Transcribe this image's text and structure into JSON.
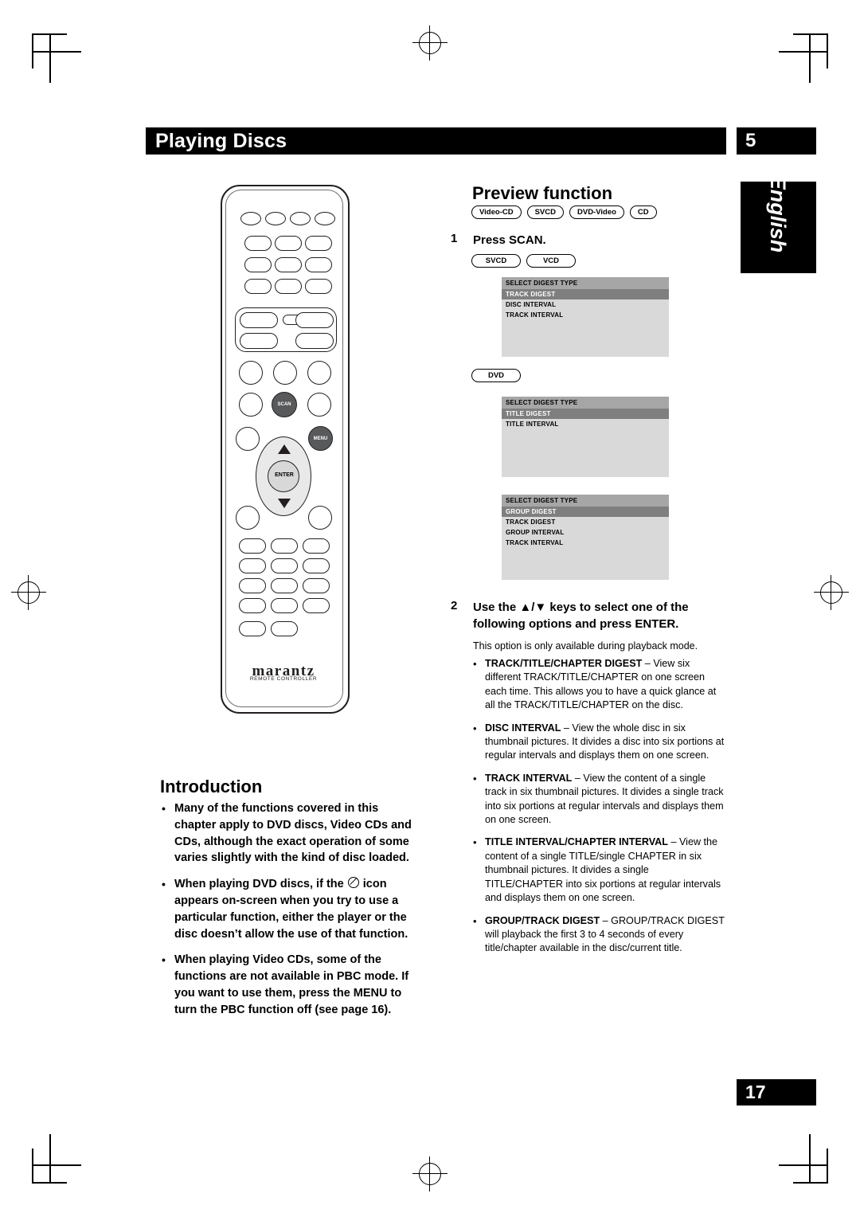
{
  "header": {
    "title": "Playing Discs",
    "chapter_number": "5",
    "language_tab": "English",
    "page_number": "17"
  },
  "remote": {
    "brand": "marantz",
    "sub_label": "REMOTE CONTROLLER",
    "scan_label": "SCAN",
    "menu_label": "MENU",
    "enter_label": "ENTER"
  },
  "left": {
    "intro_heading": "Introduction",
    "bullets": [
      "Many of the functions covered in this chapter apply to DVD discs, Video CDs and CDs, although the exact operation of some varies slightly with the kind of disc loaded.",
      "When playing DVD discs, if the ⊘ icon appears on-screen when you try to use a particular function, either the player or the disc doesn’t allow the use of that function.",
      "When playing Video CDs, some of the functions are not available in PBC mode. If you want to use them, press the MENU to turn the PBC function off (see page 16)."
    ]
  },
  "right": {
    "heading": "Preview function",
    "disc_badges": [
      "Video-CD",
      "SVCD",
      "DVD-Video",
      "CD"
    ],
    "step1_num": "1",
    "step1_text": "Press SCAN.",
    "badges_svcd_vcd": [
      "SVCD",
      "VCD"
    ],
    "osd_svcd": {
      "header": "SELECT DIGEST TYPE",
      "rows": [
        {
          "label": "TRACK DIGEST",
          "selected": true
        },
        {
          "label": "DISC INTERVAL",
          "selected": false
        },
        {
          "label": "TRACK INTERVAL",
          "selected": false
        }
      ]
    },
    "badge_dvd": "DVD",
    "osd_dvd_1": {
      "header": "SELECT DIGEST TYPE",
      "rows": [
        {
          "label": "TITLE DIGEST",
          "selected": true
        },
        {
          "label": "TITLE INTERVAL",
          "selected": false
        }
      ]
    },
    "osd_dvd_2": {
      "header": "SELECT DIGEST TYPE",
      "rows": [
        {
          "label": "GROUP  DIGEST",
          "selected": true
        },
        {
          "label": "TRACK   DIGEST",
          "selected": false
        },
        {
          "label": "GROUP  INTERVAL",
          "selected": false
        },
        {
          "label": "TRACK   INTERVAL",
          "selected": false
        }
      ]
    },
    "step2_num": "2",
    "step2_text": "Use the ▲/▼ keys to select one of the following options and press ENTER.",
    "note": "This option is only available during playback mode.",
    "options": [
      {
        "term": "TRACK/TITLE/CHAPTER DIGEST",
        "desc": " – View six different TRACK/TITLE/CHAPTER on one screen each time. This allows you to have a quick glance at all the TRACK/TITLE/CHAPTER on the disc."
      },
      {
        "term": "DISC INTERVAL",
        "desc": " – View the whole disc in six thumbnail pictures. It divides a disc into six portions at regular intervals and displays them on one screen."
      },
      {
        "term": "TRACK INTERVAL",
        "desc": " – View the content of a single track in six thumbnail pictures. It divides a single track into six portions at regular intervals and displays them on one screen."
      },
      {
        "term": "TITLE INTERVAL/CHAPTER INTERVAL",
        "desc": " – View the content of a single TITLE/single CHAPTER in six thumbnail pictures. It divides a single TITLE/CHAPTER into six portions at regular intervals and displays them on one screen."
      },
      {
        "term": "GROUP/TRACK DIGEST",
        "desc": " – GROUP/TRACK DIGEST will playback the first 3 to 4 seconds of every title/chapter available in the disc/current title."
      }
    ]
  },
  "colors": {
    "bar": "#000000",
    "osd_bg": "#d9d9d9",
    "osd_header": "#a6a6a6",
    "osd_selected": "#7f7f7f"
  }
}
